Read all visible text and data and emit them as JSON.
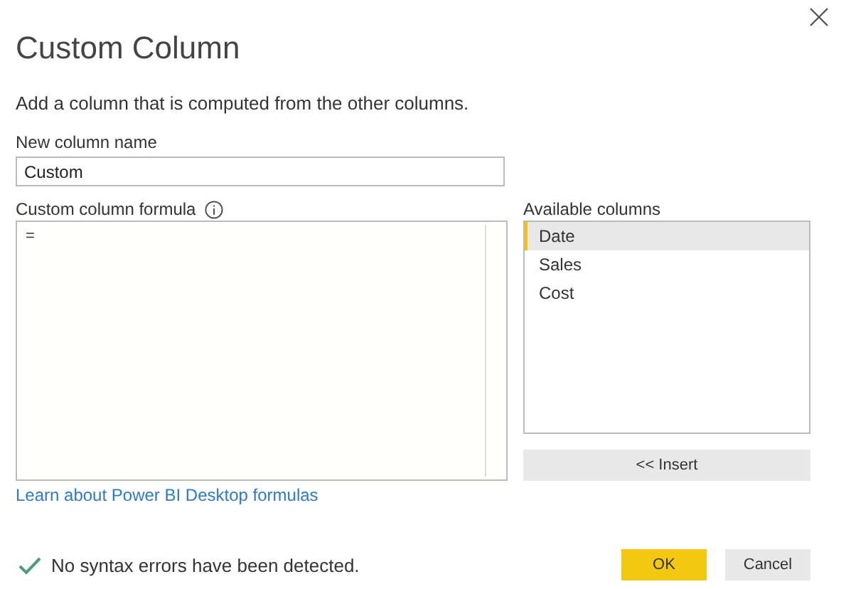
{
  "dialog": {
    "title": "Custom Column",
    "description": "Add a column that is computed from the other columns.",
    "name_label": "New column name",
    "name_value": "Custom",
    "formula_label": "Custom column formula",
    "formula_value": "=",
    "columns_label": "Available columns",
    "columns": [
      {
        "label": "Date",
        "selected": true
      },
      {
        "label": "Sales",
        "selected": false
      },
      {
        "label": "Cost",
        "selected": false
      }
    ],
    "insert_button": "<< Insert",
    "help_link": "Learn about Power BI Desktop formulas",
    "status": {
      "ok": true,
      "text": "No syntax errors have been detected."
    },
    "buttons": [
      {
        "label": "OK",
        "kind": "primary"
      },
      {
        "label": "Cancel",
        "kind": "secondary"
      }
    ]
  }
}
